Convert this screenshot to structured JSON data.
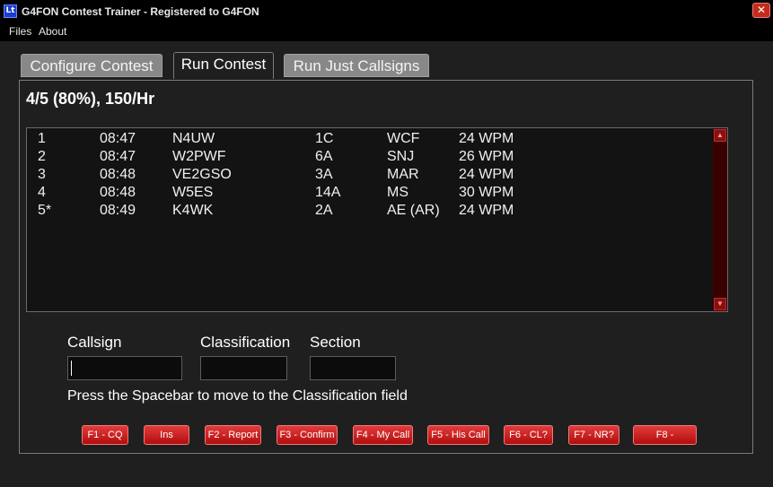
{
  "window": {
    "title": "G4FON Contest Trainer - Registered to G4FON",
    "icon_text": "Lt",
    "close_glyph": "✕"
  },
  "menu": [
    "Files",
    "About"
  ],
  "tabs": [
    "Configure Contest",
    "Run Contest",
    "Run Just Callsigns"
  ],
  "active_tab": "Run Contest",
  "stats": "4/5 (80%), 150/Hr",
  "log": [
    {
      "num": "1",
      "time": "08:47",
      "call": "N4UW",
      "class": "1C",
      "section": "WCF",
      "speed": "24 WPM"
    },
    {
      "num": "2",
      "time": "08:47",
      "call": "W2PWF",
      "class": "6A",
      "section": "SNJ",
      "speed": "26 WPM"
    },
    {
      "num": "3",
      "time": "08:48",
      "call": "VE2GSO",
      "class": "3A",
      "section": "MAR",
      "speed": "24 WPM"
    },
    {
      "num": "4",
      "time": "08:48",
      "call": "W5ES",
      "class": "14A",
      "section": "MS",
      "speed": "30 WPM"
    },
    {
      "num": "5*",
      "time": "08:49",
      "call": "K4WK",
      "class": "2A",
      "section": "AE (AR)",
      "speed": "24 WPM"
    }
  ],
  "form": {
    "callsign_label": "Callsign",
    "classification_label": "Classification",
    "section_label": "Section",
    "callsign_value": "",
    "classification_value": "",
    "section_value": "",
    "hint": "Press the Spacebar to move to the Classification field"
  },
  "fkeys": [
    "F1 - CQ",
    "Ins",
    "F2 - Report",
    "F3 - Confirm",
    "F4 - My Call",
    "F5 - His Call",
    "F6 - CL?",
    "F7 - NR?",
    "F8 -"
  ],
  "colors": {
    "background": "#1f1f1f",
    "button_red": "#c42020",
    "scrollbar": "#3a0000"
  }
}
